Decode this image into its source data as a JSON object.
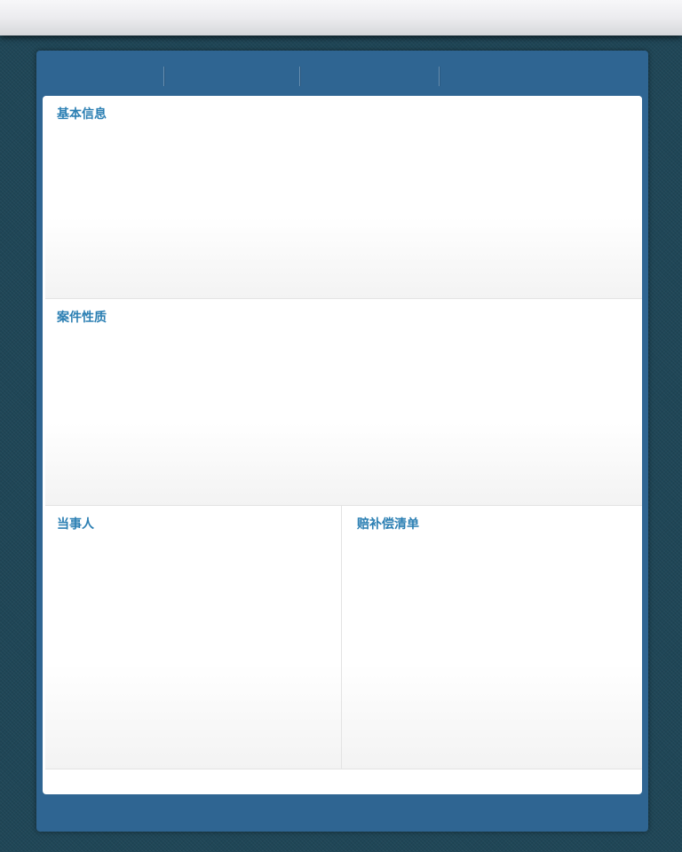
{
  "tabs": [
    {
      "label": ""
    },
    {
      "label": ""
    },
    {
      "label": ""
    },
    {
      "label": ""
    }
  ],
  "sections": {
    "basic_info": {
      "title": "基本信息"
    },
    "case_nature": {
      "title": "案件性质"
    },
    "parties": {
      "title": "当事人"
    },
    "compensation_list": {
      "title": "赔补偿清单"
    }
  }
}
